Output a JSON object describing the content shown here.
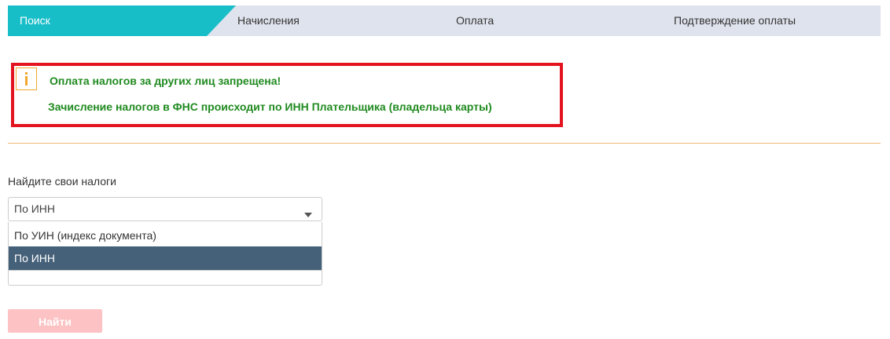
{
  "stepper": {
    "steps": [
      {
        "label": "Поиск",
        "active": true
      },
      {
        "label": "Начисления",
        "active": false
      },
      {
        "label": "Оплата",
        "active": false
      },
      {
        "label": "Подтверждение оплаты",
        "active": false
      }
    ],
    "active_color": "#17bec8",
    "inactive_color": "#dfe3ed"
  },
  "warning": {
    "icon": "info-icon",
    "line1": "Оплата налогов за других лиц запрещена!",
    "line2": "Зачисление налогов в ФНС происходит по ИНН Плательщика (владельца карты)",
    "border_color": "#e3141f",
    "text_color": "#1f8a1f"
  },
  "search": {
    "label": "Найдите свои налоги",
    "select": {
      "value": "По ИНН",
      "options": [
        "По УИН (индекс документа)",
        "По ИНН"
      ],
      "highlighted_index": 1
    },
    "submit_label": "Найти"
  }
}
